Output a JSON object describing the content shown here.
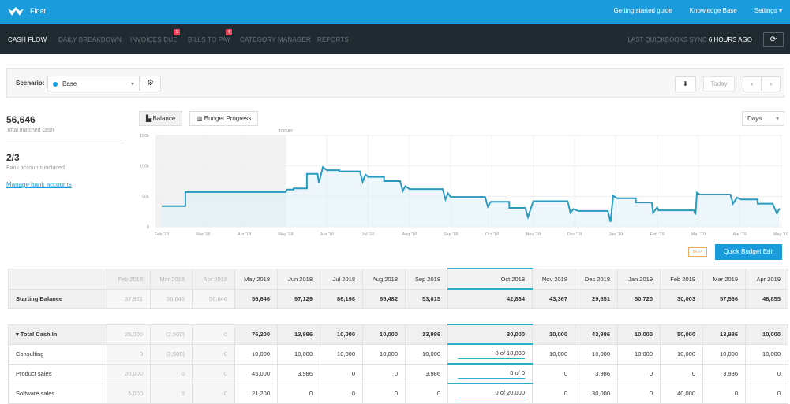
{
  "app": {
    "name": "Float"
  },
  "topbar": {
    "links": [
      "Getting started guide",
      "Knowledge Base",
      "Settings ▾"
    ]
  },
  "nav": {
    "tabs": [
      {
        "label": "CASH FLOW",
        "active": true
      },
      {
        "label": "DAILY BREAKDOWN"
      },
      {
        "label": "INVOICES DUE",
        "badge": "1"
      },
      {
        "label": "BILLS TO PAY",
        "badge": "4"
      },
      {
        "label": "CATEGORY MANAGER"
      },
      {
        "label": "REPORTS"
      }
    ],
    "sync_label": "LAST QUICKBOOKS SYNC",
    "sync_value": "6 HOURS AGO",
    "refresh_icon": "refresh-icon"
  },
  "toolbar": {
    "scenario_label": "Scenario:",
    "scenario_value": "Base",
    "scenario_color": "#1a9bdc",
    "today": "Today",
    "prev": "‹",
    "next": "›"
  },
  "stats": {
    "cash": "56,646",
    "cash_label": "Total matched cash",
    "accounts": "2/3",
    "accounts_label": "Bank accounts included",
    "manage": "Manage bank accounts"
  },
  "chart_controls": {
    "balance": "Balance",
    "budget": "Budget Progress",
    "period": "Days",
    "beta": "BETA",
    "quick_edit": "Quick Budget Edit"
  },
  "chart_data": {
    "type": "area",
    "today_label": "TODAY",
    "today": "2018-05-01",
    "ylim": [
      0,
      150000
    ],
    "yticks": [
      {
        "v": 0,
        "label": "0"
      },
      {
        "v": 50000,
        "label": "50k"
      },
      {
        "v": 100000,
        "label": "100k"
      },
      {
        "v": 150000,
        "label": "150k"
      }
    ],
    "xticks": [
      "Feb '18",
      "Mar '18",
      "Apr '18",
      "May '18",
      "Jun '18",
      "Jul '18",
      "Aug '18",
      "Sep '18",
      "Oct '18",
      "Nov '18",
      "Dec '18",
      "Jan '19",
      "Feb '19",
      "Mar '19",
      "Apr '19",
      "May '19"
    ],
    "grid": true,
    "color": "#2a9bbf",
    "points": [
      [
        "2018-02-01",
        34000
      ],
      [
        "2018-02-17",
        34000
      ],
      [
        "2018-02-17",
        57000
      ],
      [
        "2018-05-01",
        57000
      ],
      [
        "2018-05-02",
        61000
      ],
      [
        "2018-05-07",
        61000
      ],
      [
        "2018-05-07",
        63000
      ],
      [
        "2018-05-17",
        63000
      ],
      [
        "2018-05-17",
        87000
      ],
      [
        "2018-05-25",
        87000
      ],
      [
        "2018-05-26",
        72000
      ],
      [
        "2018-05-29",
        98000
      ],
      [
        "2018-06-01",
        93000
      ],
      [
        "2018-06-10",
        93000
      ],
      [
        "2018-06-10",
        91000
      ],
      [
        "2018-06-25",
        91000
      ],
      [
        "2018-06-27",
        74000
      ],
      [
        "2018-06-29",
        86000
      ],
      [
        "2018-07-01",
        82000
      ],
      [
        "2018-07-13",
        82000
      ],
      [
        "2018-07-13",
        75000
      ],
      [
        "2018-07-25",
        75000
      ],
      [
        "2018-07-27",
        59000
      ],
      [
        "2018-07-29",
        67000
      ],
      [
        "2018-08-01",
        62000
      ],
      [
        "2018-08-26",
        62000
      ],
      [
        "2018-08-28",
        45000
      ],
      [
        "2018-08-30",
        55000
      ],
      [
        "2018-09-01",
        49000
      ],
      [
        "2018-09-26",
        49000
      ],
      [
        "2018-09-28",
        33000
      ],
      [
        "2018-09-30",
        41000
      ],
      [
        "2018-10-14",
        41000
      ],
      [
        "2018-10-14",
        31000
      ],
      [
        "2018-10-26",
        31000
      ],
      [
        "2018-10-28",
        16000
      ],
      [
        "2018-11-01",
        42000
      ],
      [
        "2018-11-26",
        42000
      ],
      [
        "2018-11-28",
        23000
      ],
      [
        "2018-11-30",
        29000
      ],
      [
        "2018-12-04",
        26000
      ],
      [
        "2018-12-26",
        26000
      ],
      [
        "2018-12-28",
        8000
      ],
      [
        "2018-12-30",
        51000
      ],
      [
        "2019-01-02",
        47000
      ],
      [
        "2019-01-16",
        47000
      ],
      [
        "2019-01-16",
        40000
      ],
      [
        "2019-01-28",
        40000
      ],
      [
        "2019-01-29",
        23000
      ],
      [
        "2019-02-01",
        32000
      ],
      [
        "2019-02-02",
        27000
      ],
      [
        "2019-02-26",
        27000
      ],
      [
        "2019-02-27",
        20000
      ],
      [
        "2019-02-28",
        56000
      ],
      [
        "2019-03-02",
        53000
      ],
      [
        "2019-03-25",
        53000
      ],
      [
        "2019-03-27",
        38000
      ],
      [
        "2019-03-30",
        48000
      ],
      [
        "2019-04-02",
        45000
      ],
      [
        "2019-04-14",
        45000
      ],
      [
        "2019-04-14",
        38000
      ],
      [
        "2019-04-25",
        38000
      ],
      [
        "2019-04-28",
        22000
      ],
      [
        "2019-04-30",
        30000
      ]
    ]
  },
  "table": {
    "months": [
      "Feb 2018",
      "Mar 2018",
      "Apr 2018",
      "May 2018",
      "Jun 2018",
      "Jul 2018",
      "Aug 2018",
      "Sep 2018",
      "Oct 2018",
      "Nov 2018",
      "Dec 2018",
      "Jan 2019",
      "Feb 2019",
      "Mar 2019",
      "Apr 2019"
    ],
    "past_count": 3,
    "current_index": 8,
    "starting_balance": {
      "label": "Starting Balance",
      "values": [
        "37,921",
        "56,646",
        "56,646",
        "56,646",
        "97,129",
        "86,198",
        "65,482",
        "53,015",
        "42,834",
        "43,367",
        "29,651",
        "50,720",
        "30,003",
        "57,536",
        "48,855"
      ]
    },
    "groups": [
      {
        "label": "Total Cash In",
        "expand_icon": "caret-down-icon",
        "values": [
          "25,000",
          "(2,500)",
          "0",
          "76,200",
          "13,986",
          "10,000",
          "10,000",
          "13,986",
          "30,000",
          "10,000",
          "43,986",
          "10,000",
          "50,000",
          "13,986",
          "10,000"
        ],
        "rows": [
          {
            "label": "Consulting",
            "values": [
              "0",
              "(2,500)",
              "0",
              "10,000",
              "10,000",
              "10,000",
              "10,000",
              "10,000",
              "0 of 10,000",
              "10,000",
              "10,000",
              "10,000",
              "10,000",
              "10,000",
              "10,000"
            ]
          },
          {
            "label": "Product sales",
            "values": [
              "20,000",
              "0",
              "0",
              "45,000",
              "3,986",
              "0",
              "0",
              "3,986",
              "0 of 0",
              "0",
              "3,986",
              "0",
              "0",
              "3,986",
              "0"
            ]
          },
          {
            "label": "Software sales",
            "values": [
              "5,000",
              "0",
              "0",
              "21,200",
              "0",
              "0",
              "0",
              "0",
              "0 of 20,000",
              "0",
              "30,000",
              "0",
              "40,000",
              "0",
              "0"
            ]
          }
        ]
      }
    ]
  }
}
